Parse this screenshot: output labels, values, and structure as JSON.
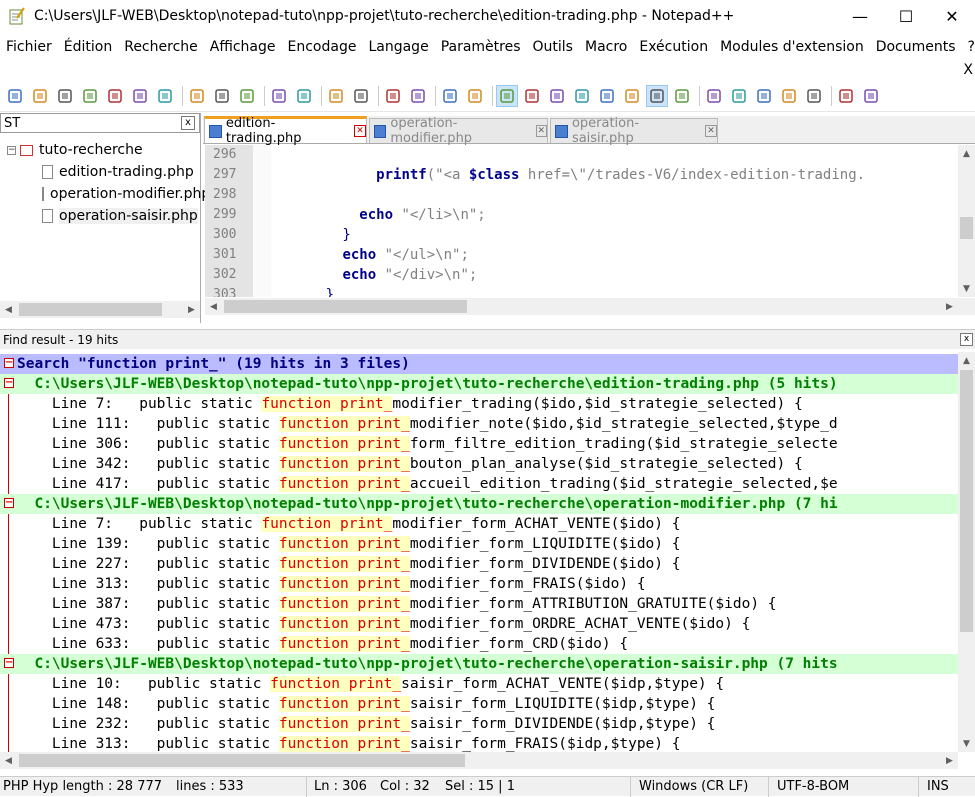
{
  "window": {
    "title": "C:\\Users\\JLF-WEB\\Desktop\\notepad-tuto\\npp-projet\\tuto-recherche\\edition-trading.php - Notepad++",
    "minimize": "—",
    "maximize": "☐",
    "close": "✕"
  },
  "menu": {
    "items": [
      "Fichier",
      "Édition",
      "Recherche",
      "Affichage",
      "Encodage",
      "Langage",
      "Paramètres",
      "Outils",
      "Macro",
      "Exécution",
      "Modules d'extension",
      "Documents",
      "?"
    ],
    "close_x": "X"
  },
  "toolbar": {
    "icons": [
      "new-file-icon",
      "open-file-icon",
      "save-icon",
      "save-all-icon",
      "close-icon",
      "close-all-icon",
      "print-icon",
      "sep",
      "cut-icon",
      "copy-icon",
      "paste-icon",
      "sep",
      "undo-icon",
      "redo-icon",
      "sep",
      "find-icon",
      "replace-icon",
      "sep",
      "zoom-in-icon",
      "zoom-out-icon",
      "sep",
      "sync-vertical-icon",
      "sync-horizontal-icon",
      "sep",
      "word-wrap-icon",
      "show-all-chars-icon",
      "indent-guide-icon",
      "doc-map-icon",
      "function-list-icon",
      "folder-as-workspace-icon",
      "doc-list-icon",
      "monitoring-icon",
      "sep",
      "record-macro-icon",
      "stop-macro-icon",
      "play-macro-icon",
      "run-macro-multiple-icon",
      "save-macro-icon",
      "sep",
      "spell-check-icon",
      "plugin-icon"
    ]
  },
  "left_panel": {
    "search_value": "ST",
    "close": "x",
    "root": "tuto-recherche",
    "root_toggle": "−",
    "files": [
      "edition-trading.php",
      "operation-modifier.php",
      "operation-saisir.php"
    ]
  },
  "tabs": [
    {
      "label": "edition-trading.php",
      "active": true
    },
    {
      "label": "operation-modifier.php",
      "active": false
    },
    {
      "label": "operation-saisir.php",
      "active": false
    }
  ],
  "editor": {
    "lines": [
      {
        "num": "296",
        "segments": []
      },
      {
        "num": "297",
        "segments": [
          {
            "t": "            ",
            "c": ""
          },
          {
            "t": "printf",
            "c": "kw"
          },
          {
            "t": "(\"<a ",
            "c": "str"
          },
          {
            "t": "$class",
            "c": "var"
          },
          {
            "t": " href=\\\"/trades-V6/index-edition-trading.",
            "c": "str"
          }
        ]
      },
      {
        "num": "298",
        "segments": []
      },
      {
        "num": "299",
        "segments": [
          {
            "t": "          ",
            "c": ""
          },
          {
            "t": "echo",
            "c": "kw"
          },
          {
            "t": " \"</li>\\n\";",
            "c": "str"
          }
        ]
      },
      {
        "num": "300",
        "segments": [
          {
            "t": "        }",
            "c": "brace"
          }
        ]
      },
      {
        "num": "301",
        "segments": [
          {
            "t": "        ",
            "c": ""
          },
          {
            "t": "echo",
            "c": "kw"
          },
          {
            "t": " \"</ul>\\n\";",
            "c": "str"
          }
        ]
      },
      {
        "num": "302",
        "segments": [
          {
            "t": "        ",
            "c": ""
          },
          {
            "t": "echo",
            "c": "kw"
          },
          {
            "t": " \"</div>\\n\";",
            "c": "str"
          }
        ]
      },
      {
        "num": "303",
        "segments": [
          {
            "t": "      }",
            "c": "brace"
          }
        ]
      }
    ]
  },
  "find": {
    "header": "Find result - 19 hits",
    "close": "x",
    "lines": [
      {
        "type": "search",
        "text": "Search \"function print_\" (19 hits in 3 files)"
      },
      {
        "type": "file",
        "text": "  C:\\Users\\JLF-WEB\\Desktop\\notepad-tuto\\npp-projet\\tuto-recherche\\edition-trading.php (5 hits)"
      },
      {
        "type": "hit",
        "pre": "    Line 7:   public static ",
        "kw": "function print_",
        "post": "modifier_trading($ido,$id_strategie_selected) {"
      },
      {
        "type": "hit",
        "pre": "    Line 111:   public static ",
        "kw": "function print_",
        "post": "modifier_note($ido,$id_strategie_selected,$type_d"
      },
      {
        "type": "hit",
        "pre": "    Line 306:   public static ",
        "kw": "function print_",
        "post": "form_filtre_edition_trading($id_strategie_selecte"
      },
      {
        "type": "hit",
        "pre": "    Line 342:   public static ",
        "kw": "function print_",
        "post": "bouton_plan_analyse($id_strategie_selected) {"
      },
      {
        "type": "hit",
        "pre": "    Line 417:   public static ",
        "kw": "function print_",
        "post": "accueil_edition_trading($id_strategie_selected,$e"
      },
      {
        "type": "file",
        "text": "  C:\\Users\\JLF-WEB\\Desktop\\notepad-tuto\\npp-projet\\tuto-recherche\\operation-modifier.php (7 hi"
      },
      {
        "type": "hit",
        "pre": "    Line 7:   public static ",
        "kw": "function print_",
        "post": "modifier_form_ACHAT_VENTE($ido) {"
      },
      {
        "type": "hit",
        "pre": "    Line 139:   public static ",
        "kw": "function print_",
        "post": "modifier_form_LIQUIDITE($ido) {"
      },
      {
        "type": "hit",
        "pre": "    Line 227:   public static ",
        "kw": "function print_",
        "post": "modifier_form_DIVIDENDE($ido) {"
      },
      {
        "type": "hit",
        "pre": "    Line 313:   public static ",
        "kw": "function print_",
        "post": "modifier_form_FRAIS($ido) {"
      },
      {
        "type": "hit",
        "pre": "    Line 387:   public static ",
        "kw": "function print_",
        "post": "modifier_form_ATTRIBUTION_GRATUITE($ido) {"
      },
      {
        "type": "hit",
        "pre": "    Line 473:   public static ",
        "kw": "function print_",
        "post": "modifier_form_ORDRE_ACHAT_VENTE($ido) {"
      },
      {
        "type": "hit",
        "pre": "    Line 633:   public static ",
        "kw": "function print_",
        "post": "modifier_form_CRD($ido) {"
      },
      {
        "type": "file",
        "text": "  C:\\Users\\JLF-WEB\\Desktop\\notepad-tuto\\npp-projet\\tuto-recherche\\operation-saisir.php (7 hits"
      },
      {
        "type": "hit",
        "pre": "    Line 10:   public static ",
        "kw": "function print_",
        "post": "saisir_form_ACHAT_VENTE($idp,$type) {"
      },
      {
        "type": "hit",
        "pre": "    Line 148:   public static ",
        "kw": "function print_",
        "post": "saisir_form_LIQUIDITE($idp,$type) {"
      },
      {
        "type": "hit",
        "pre": "    Line 232:   public static ",
        "kw": "function print_",
        "post": "saisir_form_DIVIDENDE($idp,$type) {"
      },
      {
        "type": "hit",
        "pre": "    Line 313:   public static ",
        "kw": "function print_",
        "post": "saisir_form_FRAIS($idp,$type) {"
      }
    ]
  },
  "status": {
    "language": "PHP Hyp length : 28 777",
    "lines": "lines : 533",
    "ln": "Ln : 306",
    "col": "Col : 32",
    "sel": "Sel : 15 | 1",
    "eol": "Windows (CR LF)",
    "encoding": "UTF-8-BOM",
    "mode": "INS"
  },
  "colors": {
    "search_bg": "#bbbbff",
    "file_bg": "#d5ffd5",
    "hit_bg": "#ffffbf",
    "hit_fg": "#e00000",
    "active_tab_accent": "#f0a020"
  }
}
